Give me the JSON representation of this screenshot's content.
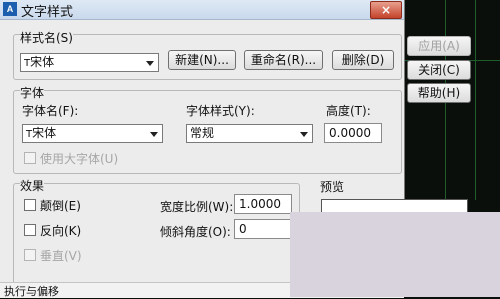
{
  "window": {
    "title": "文字样式",
    "close_label": "×"
  },
  "style_name": {
    "label": "样式名(S)",
    "value": "宋体",
    "new_button": "新建(N)...",
    "rename_button": "重命名(R)...",
    "delete_button": "删除(D)"
  },
  "side_buttons": {
    "apply": "应用(A)",
    "close": "关闭(C)",
    "help": "帮助(H)"
  },
  "font": {
    "group_label": "字体",
    "font_name_label": "字体名(F):",
    "font_name_value": "宋体",
    "font_style_label": "字体样式(Y):",
    "font_style_value": "常规",
    "height_label": "高度(T):",
    "height_value": "0.0000",
    "use_big_font": "使用大字体(U)"
  },
  "effects": {
    "group_label": "效果",
    "upside_down": "颠倒(E)",
    "backwards": "反向(K)",
    "vertical": "垂直(V)",
    "width_factor_label": "宽度比例(W):",
    "width_factor_value": "1.0000",
    "oblique_angle_label": "倾斜角度(O):",
    "oblique_angle_value": "0"
  },
  "preview": {
    "label": "预览"
  },
  "bottom_text": "执行与偏移"
}
